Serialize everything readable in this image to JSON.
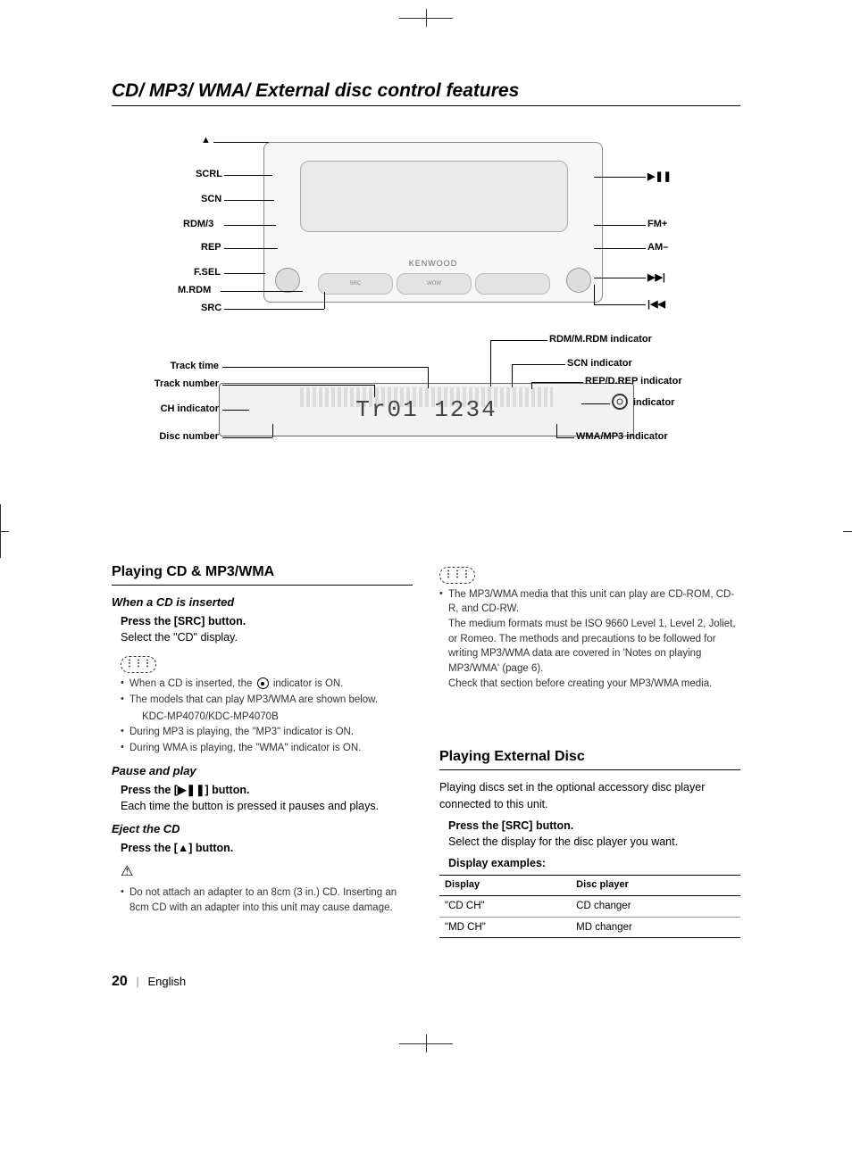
{
  "page_title": "CD/ MP3/ WMA/ External disc control features",
  "diagram": {
    "brand": "KENWOOD",
    "display_text": "Tr01  1234",
    "buttons": {
      "src": "SRC",
      "wow": "WOW"
    },
    "left_labels": {
      "eject": "▲",
      "scrl": "SCRL",
      "scn": "SCN",
      "rdm3": "RDM/3",
      "rep": "REP",
      "fsel": "F.SEL",
      "mrdm": "M.RDM",
      "src": "SRC"
    },
    "right_labels": {
      "playpause": "▶❚❚",
      "fmplus": "FM+",
      "amminus": "AM–",
      "next": "▶▶|",
      "prev": "|◀◀"
    },
    "lcd_left": {
      "track_time": "Track time",
      "track_number": "Track number",
      "ch_indicator": "CH indicator",
      "disc_number": "Disc number"
    },
    "lcd_right": {
      "rdm_mrdm": "RDM/M.RDM indicator",
      "scn": "SCN indicator",
      "rep_drep": "REP/D.REP indicator",
      "disc_ind": "indicator",
      "wma_mp3": "WMA/MP3 indicator"
    }
  },
  "sections": {
    "playing_cd": {
      "heading": "Playing CD & MP3/WMA",
      "insert": {
        "title": "When a CD is inserted",
        "step": "Press the [SRC] button.",
        "body": "Select the \"CD\" display.",
        "bullets": [
          "When a CD is inserted, the  indicator is ON.",
          "The models that can play MP3/WMA are shown below.",
          "During MP3 is playing, the \"MP3\" indicator is ON.",
          "During WMA is playing, the \"WMA\" indicator is ON."
        ],
        "models": "KDC-MP4070/KDC-MP4070B"
      },
      "pause": {
        "title": "Pause and play",
        "step": "Press the [▶❚❚] button.",
        "body": "Each time the button is pressed it pauses and plays."
      },
      "eject": {
        "title": "Eject the CD",
        "step": "Press the [▲] button.",
        "bullets": [
          "Do not attach an adapter to an 8cm (3 in.) CD. Inserting an  8cm CD with an adapter into this unit may cause damage."
        ]
      }
    },
    "right_notes": {
      "b1": "The MP3/WMA media that this unit can play are CD-ROM, CD-R, and CD-RW.",
      "b2": "The medium formats must be ISO 9660 Level 1, Level 2, Joliet, or Romeo. The methods and precautions to be followed for writing MP3/WMA data are covered in 'Notes on playing MP3/WMA' (page 6).",
      "b3": "Check that section before creating your MP3/WMA media."
    },
    "external": {
      "heading": "Playing External Disc",
      "intro": "Playing discs set in the optional accessory disc player connected to this unit.",
      "step": "Press the [SRC] button.",
      "body": "Select the display for the disc player you want.",
      "examples_label": "Display examples:",
      "table": {
        "h1": "Display",
        "h2": "Disc player",
        "rows": [
          {
            "d": "\"CD CH\"",
            "p": "CD changer"
          },
          {
            "d": "\"MD CH\"",
            "p": "MD changer"
          }
        ]
      }
    }
  },
  "footer": {
    "page": "20",
    "lang": "English"
  }
}
